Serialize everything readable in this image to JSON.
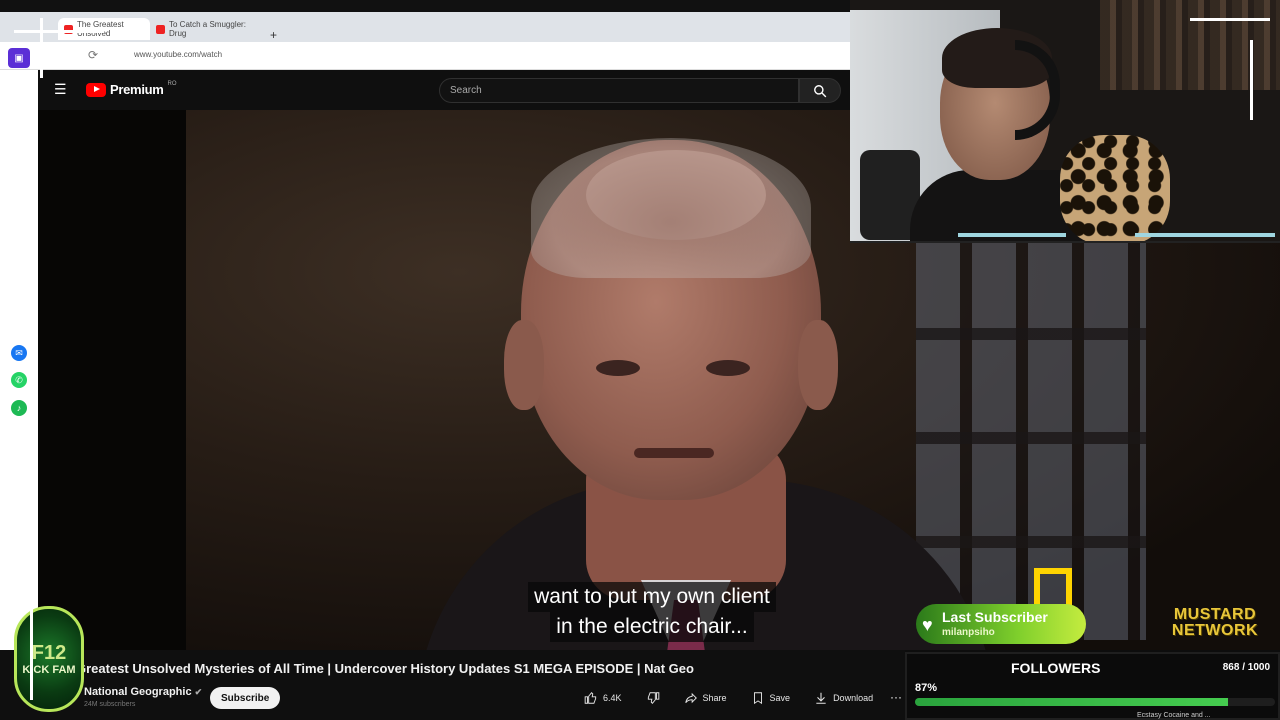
{
  "browser": {
    "tabs": [
      {
        "label": "The Greatest Unsolved"
      },
      {
        "label": "To Catch a Smuggler: Drug"
      }
    ],
    "new_tab": "+",
    "url": "www.youtube.com/watch"
  },
  "youtube": {
    "brand": "Premium",
    "region": "RO",
    "search_placeholder": "Search"
  },
  "video": {
    "caption_line1": "want to put my own client",
    "caption_line2": "in the electric chair...",
    "title": "Greatest Unsolved Mysteries of All Time | Undercover History Updates S1 MEGA EPISODE | Nat Geo",
    "channel": "National Geographic",
    "subscribers": "24M subscribers",
    "subscribe_label": "Subscribe",
    "likes": "6.4K",
    "share_label": "Share",
    "save_label": "Save",
    "download_label": "Download",
    "more_label": "···"
  },
  "overlay": {
    "logo_top": "F12",
    "logo_bottom": "KICK FAM",
    "last_sub_title": "Last Subscriber",
    "last_sub_name": "milanpsiho",
    "network_line1": "MUSTARD",
    "network_line2": "NETWORK",
    "followers_title": "FOLLOWERS",
    "followers_count": "868 / 1000",
    "followers_pct": "87%",
    "followers_progress": 0.87,
    "ticker_text": "Ecstasy Cocaine and ..."
  },
  "colors": {
    "yt_red": "#ff0000",
    "progress_green": "#3cc24a",
    "accent_yellow": "#ffd400"
  }
}
